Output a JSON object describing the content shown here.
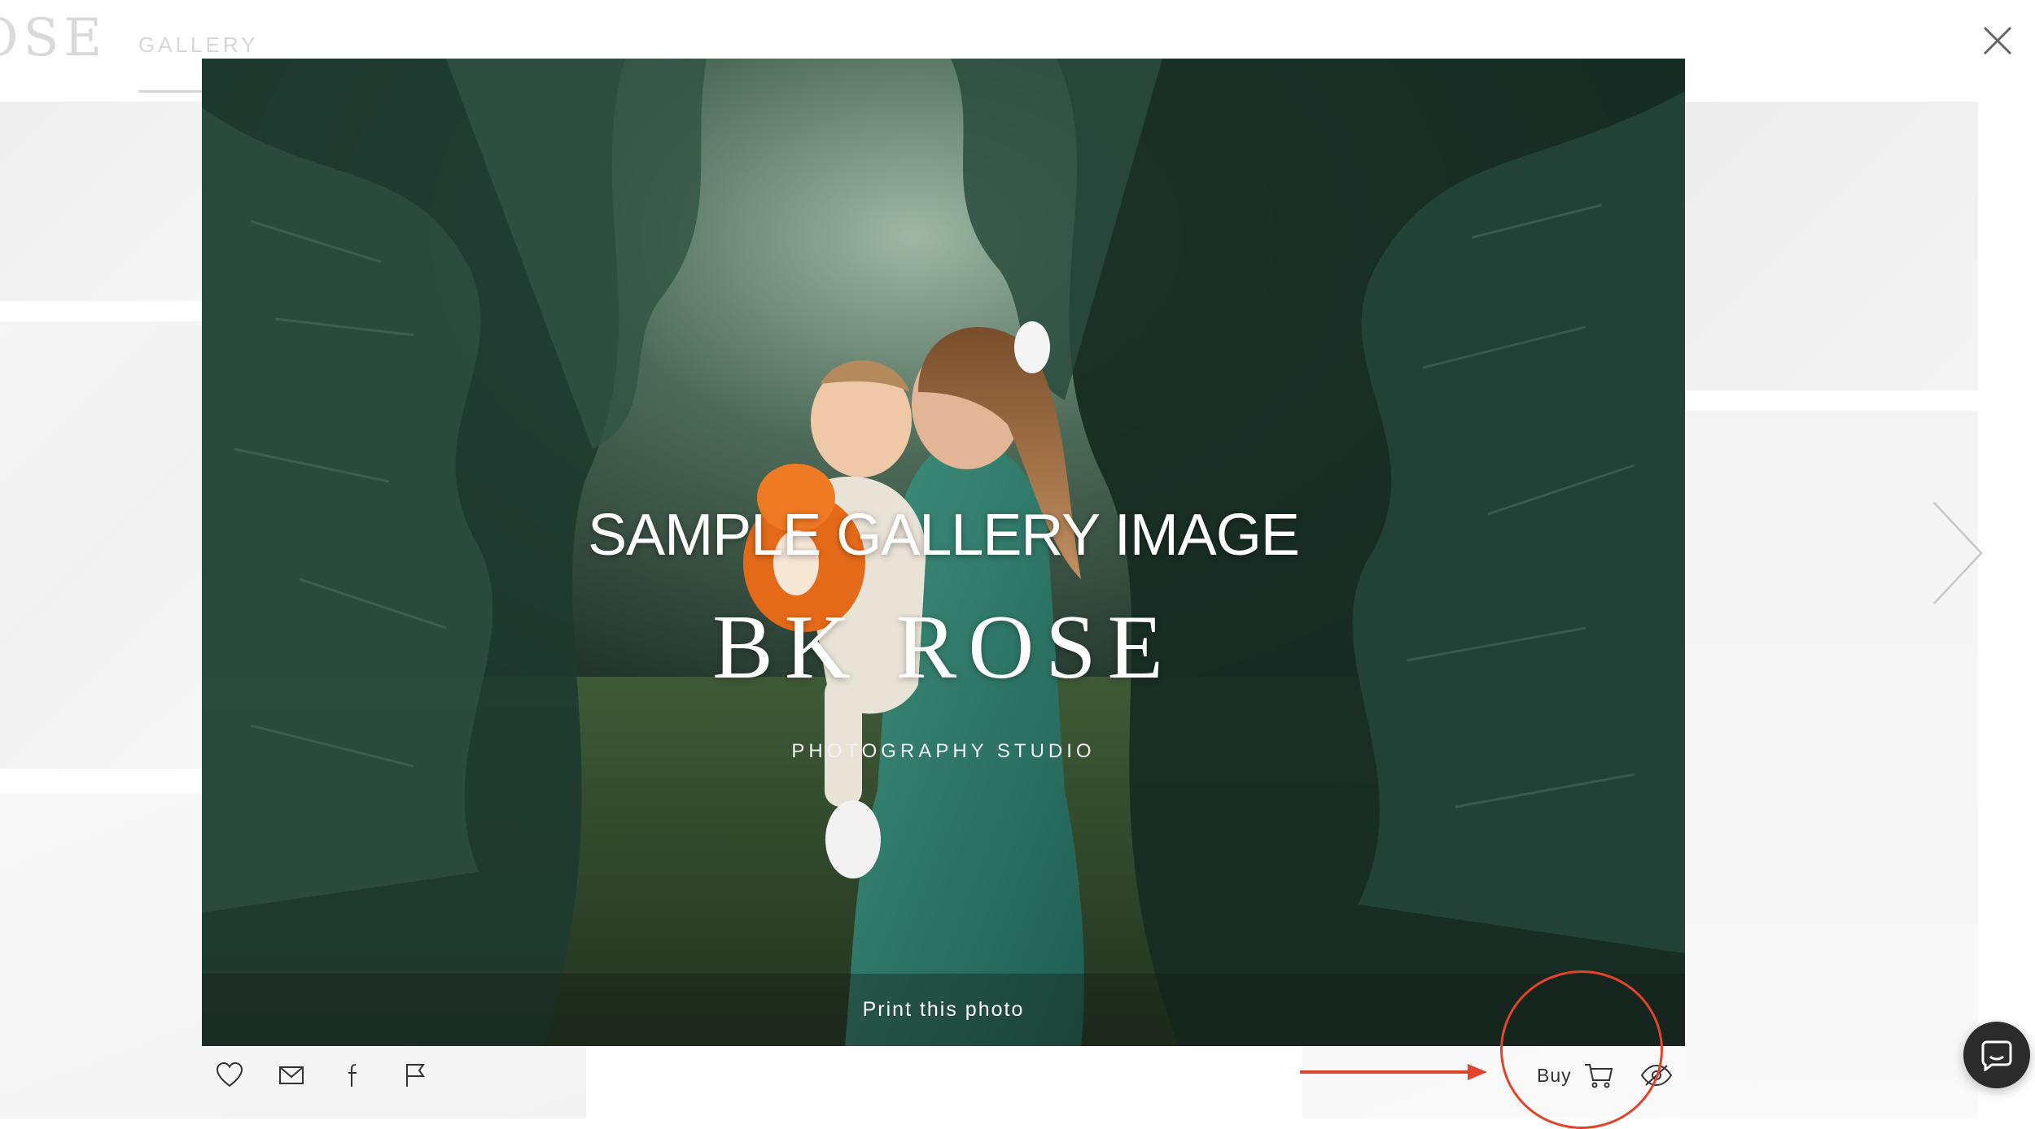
{
  "background_page": {
    "logo_text": "OSE",
    "nav_items": [
      "GALLERY"
    ]
  },
  "lightbox": {
    "watermark": {
      "title": "SAMPLE GALLERY IMAGE",
      "brand": "BK ROSE",
      "subtitle": "PHOTOGRAPHY STUDIO"
    },
    "print_link": "Print this photo",
    "actions": {
      "favorite_icon": "heart-icon",
      "email_icon": "envelope-icon",
      "facebook_icon": "facebook-icon",
      "report_icon": "flag-icon",
      "buy_label": "Buy",
      "cart_icon": "cart-icon",
      "hide_icon": "eye-slash-icon"
    },
    "close_icon": "close-icon",
    "next_icon": "chevron-right-icon"
  },
  "annotation": {
    "color": "#e0442a"
  },
  "chat_widget": {
    "icon": "chat-bubble-icon",
    "color": "#2b2b2b"
  }
}
